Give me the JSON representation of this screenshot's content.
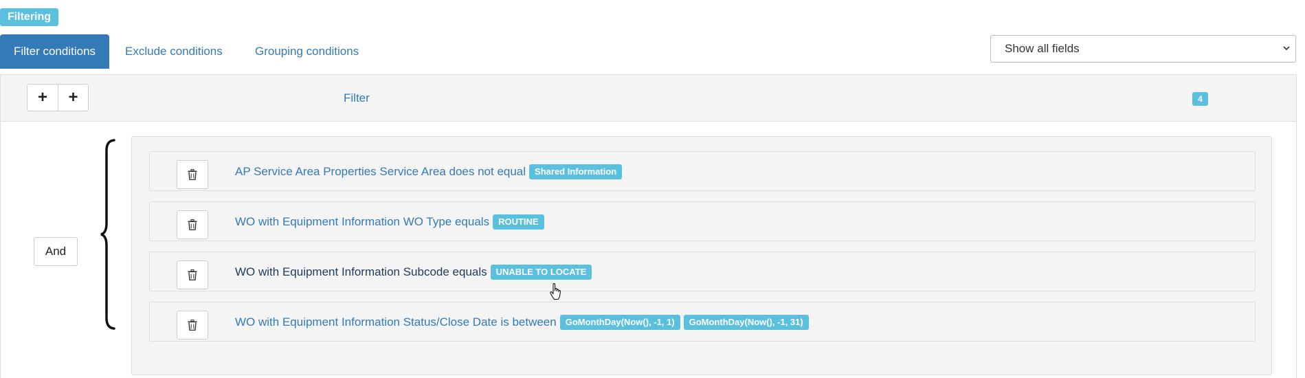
{
  "section_label": "Filtering",
  "tabs": [
    {
      "label": "Filter conditions",
      "active": true
    },
    {
      "label": "Exclude conditions",
      "active": false
    },
    {
      "label": "Grouping conditions",
      "active": false
    }
  ],
  "fields_select": {
    "value": "Show all fields"
  },
  "panel": {
    "title": "Filter",
    "count": "4",
    "add_buttons": [
      "+",
      "+"
    ]
  },
  "logic_operator": "And",
  "conditions": [
    {
      "text": "AP Service Area Properties Service Area does not equal",
      "values": [
        "Shared Information"
      ]
    },
    {
      "text": "WO with Equipment Information WO Type equals",
      "values": [
        "ROUTINE"
      ]
    },
    {
      "text": "WO with Equipment Information Subcode equals",
      "values": [
        "UNABLE TO LOCATE"
      ]
    },
    {
      "text": "WO with Equipment Information Status/Close Date is between",
      "values": [
        "GoMonthDay(Now(), -1, 1)",
        "GoMonthDay(Now(), -1, 31)"
      ]
    }
  ],
  "colors": {
    "primary": "#337ab7",
    "badge": "#5bc0de",
    "panel_bg": "#f4f4f4"
  }
}
